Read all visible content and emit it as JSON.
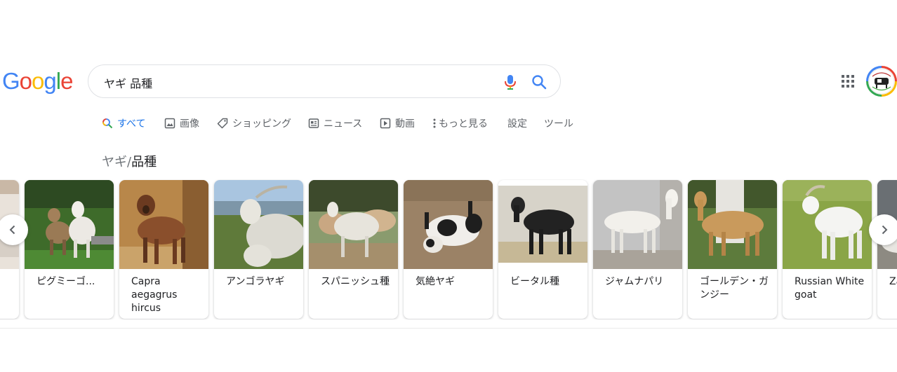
{
  "logo": {
    "letters": [
      "G",
      "o",
      "o",
      "g",
      "l",
      "e"
    ],
    "colors": [
      "#4285f4",
      "#ea4335",
      "#fbbc05",
      "#4285f4",
      "#34a853",
      "#ea4335"
    ]
  },
  "search": {
    "query": "ヤギ 品種"
  },
  "tabs": [
    {
      "label": "すべて",
      "icon": "search-icon",
      "active": true
    },
    {
      "label": "画像",
      "icon": "image-icon"
    },
    {
      "label": "ショッピング",
      "icon": "tag-icon"
    },
    {
      "label": "ニュース",
      "icon": "news-icon"
    },
    {
      "label": "動画",
      "icon": "play-icon"
    },
    {
      "label": "もっと見る",
      "icon": "more-vert-icon"
    },
    {
      "label": "設定"
    },
    {
      "label": "ツール"
    }
  ],
  "section": {
    "path_prefix": "ヤギ",
    "separator": "/",
    "title": "品種"
  },
  "breeds": [
    {
      "label": ""
    },
    {
      "label": "ピグミーゴ..."
    },
    {
      "label": "Capra aegagrus hircus"
    },
    {
      "label": "アンゴラヤギ"
    },
    {
      "label": "スパニッシュ種"
    },
    {
      "label": "気絶ヤギ"
    },
    {
      "label": "ビータル種"
    },
    {
      "label": "ジャムナパリ"
    },
    {
      "label": "ゴールデン・ガンジー"
    },
    {
      "label": "Russian White goat"
    },
    {
      "label": "Za"
    }
  ],
  "accent": "#1a73e8"
}
